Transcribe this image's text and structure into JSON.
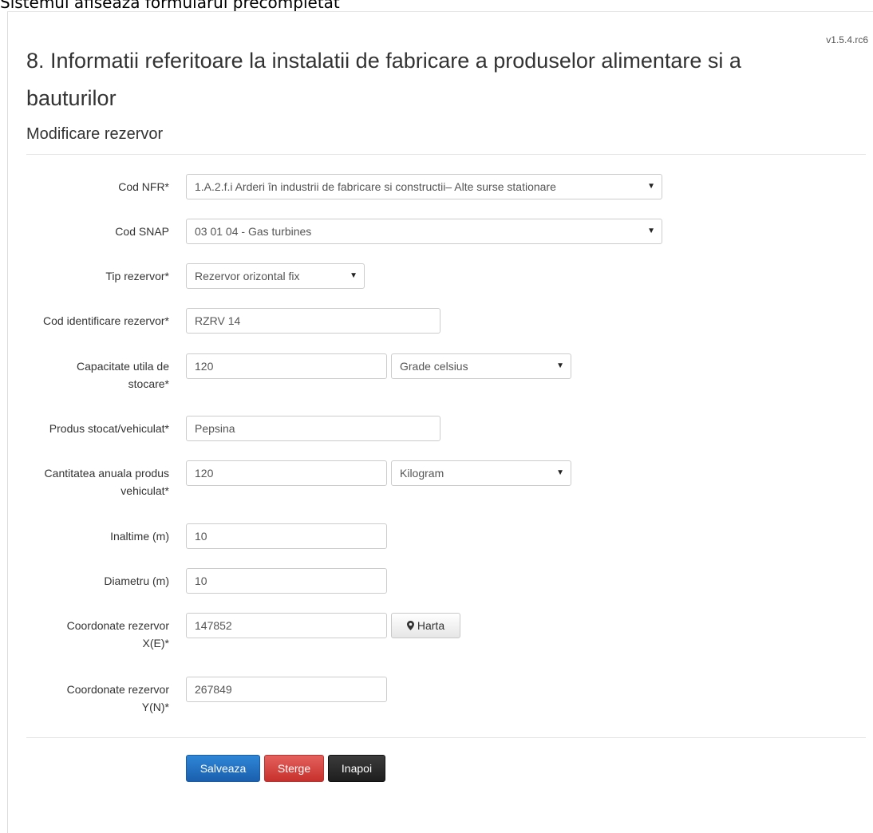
{
  "caption": "Sistemul afiseaza formularul precompletat",
  "version": "v1.5.4.rc6",
  "page_title": "8. Informatii referitoare la instalatii de fabricare a produselor alimentare si a bauturilor",
  "section_title": "Modificare rezervor",
  "fields": {
    "cod_nfr": {
      "label": "Cod NFR*",
      "value": "1.A.2.f.i Arderi în industrii de fabricare si constructii– Alte surse stationare"
    },
    "cod_snap": {
      "label": "Cod SNAP",
      "value": "03 01 04 - Gas turbines"
    },
    "tip_rezervor": {
      "label": "Tip rezervor*",
      "value": "Rezervor orizontal fix"
    },
    "cod_identificare": {
      "label": "Cod identificare rezervor*",
      "value": "RZRV 14"
    },
    "capacitate": {
      "label_line1": "Capacitate utila de",
      "label_line2": "stocare*",
      "value": "120",
      "unit": "Grade celsius"
    },
    "produs": {
      "label": "Produs stocat/vehiculat*",
      "value": "Pepsina"
    },
    "cantitate": {
      "label_line1": "Cantitatea anuala produs",
      "label_line2": "vehiculat*",
      "value": "120",
      "unit": "Kilogram"
    },
    "inaltime": {
      "label": "Inaltime (m)",
      "value": "10"
    },
    "diametru": {
      "label": "Diametru (m)",
      "value": "10"
    },
    "coord_x": {
      "label_line1": "Coordonate rezervor",
      "label_line2": "X(E)*",
      "value": "147852"
    },
    "coord_y": {
      "label_line1": "Coordonate rezervor",
      "label_line2": "Y(N)*",
      "value": "267849"
    }
  },
  "buttons": {
    "map": "Harta",
    "save": "Salveaza",
    "delete": "Sterge",
    "back": "Inapoi"
  },
  "icons": {
    "select_caret": "caret-down-icon",
    "map_pin": "map-marker-icon"
  },
  "colors": {
    "save": "#1a5fae",
    "delete": "#c7312d",
    "back": "#1e1e1e"
  }
}
